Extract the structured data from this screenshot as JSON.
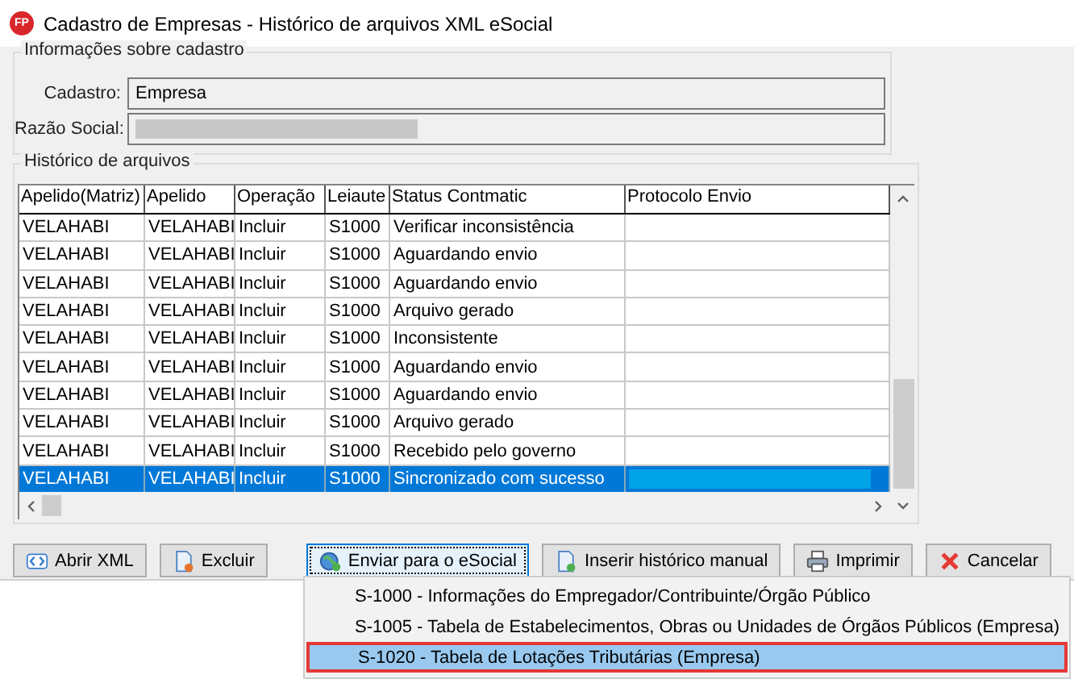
{
  "window": {
    "logo": "FP",
    "title": "Cadastro de Empresas - Histórico de arquivos XML eSocial"
  },
  "info_group": {
    "title": "Informações sobre cadastro",
    "fields": [
      {
        "label": "Cadastro:",
        "value": "Empresa",
        "redacted": false
      },
      {
        "label": "Razão Social:",
        "redacted": true
      }
    ]
  },
  "history_group": {
    "title": "Histórico de arquivos",
    "table": {
      "columns": [
        "Apelido(Matriz)",
        "Apelido",
        "Operação",
        "Leiaute",
        "Status Contmatic",
        "Protocolo Envio"
      ],
      "rows": [
        {
          "cells": [
            "VELAHABI",
            "VELAHABI",
            "Incluir",
            "S1000",
            "Verificar inconsistência"
          ],
          "protocol_redacted": false,
          "selected": false
        },
        {
          "cells": [
            "VELAHABI",
            "VELAHABI",
            "Incluir",
            "S1000",
            "Aguardando envio"
          ],
          "protocol_redacted": false,
          "selected": false
        },
        {
          "cells": [
            "VELAHABI",
            "VELAHABI",
            "Incluir",
            "S1000",
            "Aguardando envio"
          ],
          "protocol_redacted": false,
          "selected": false
        },
        {
          "cells": [
            "VELAHABI",
            "VELAHABI",
            "Incluir",
            "S1000",
            "Arquivo gerado"
          ],
          "protocol_redacted": false,
          "selected": false
        },
        {
          "cells": [
            "VELAHABI",
            "VELAHABI",
            "Incluir",
            "S1000",
            "Inconsistente"
          ],
          "protocol_redacted": false,
          "selected": false
        },
        {
          "cells": [
            "VELAHABI",
            "VELAHABI",
            "Incluir",
            "S1000",
            "Aguardando envio"
          ],
          "protocol_redacted": false,
          "selected": false
        },
        {
          "cells": [
            "VELAHABI",
            "VELAHABI",
            "Incluir",
            "S1000",
            "Aguardando envio"
          ],
          "protocol_redacted": false,
          "selected": false
        },
        {
          "cells": [
            "VELAHABI",
            "VELAHABI",
            "Incluir",
            "S1000",
            "Arquivo gerado"
          ],
          "protocol_redacted": false,
          "selected": false
        },
        {
          "cells": [
            "VELAHABI",
            "VELAHABI",
            "Incluir",
            "S1000",
            "Recebido pelo governo"
          ],
          "protocol_redacted": false,
          "selected": false
        },
        {
          "cells": [
            "VELAHABI",
            "VELAHABI",
            "Incluir",
            "S1000",
            "Sincronizado com sucesso"
          ],
          "protocol_redacted": true,
          "selected": true
        }
      ]
    }
  },
  "buttons": [
    {
      "label": "Abrir XML",
      "kind": "xml",
      "focused": false
    },
    {
      "label": "Excluir",
      "kind": "delete",
      "focused": false
    },
    {
      "label": "Enviar para o eSocial",
      "kind": "send",
      "focused": true
    },
    {
      "label": "Inserir histórico manual",
      "kind": "insert",
      "focused": false
    },
    {
      "label": "Imprimir",
      "kind": "print",
      "focused": false
    },
    {
      "label": "Cancelar",
      "kind": "cancel",
      "focused": false
    }
  ],
  "dropdown_menu": {
    "items": [
      {
        "label": "S-1000 - Informações do Empregador/Contribuinte/Órgão Público",
        "selected": false
      },
      {
        "label": "S-1005 - Tabela de Estabelecimentos, Obras ou Unidades de Órgãos Públicos (Empresa)",
        "selected": false
      },
      {
        "label": "S-1020 - Tabela de Lotações Tributárias (Empresa)",
        "selected": true
      }
    ]
  }
}
